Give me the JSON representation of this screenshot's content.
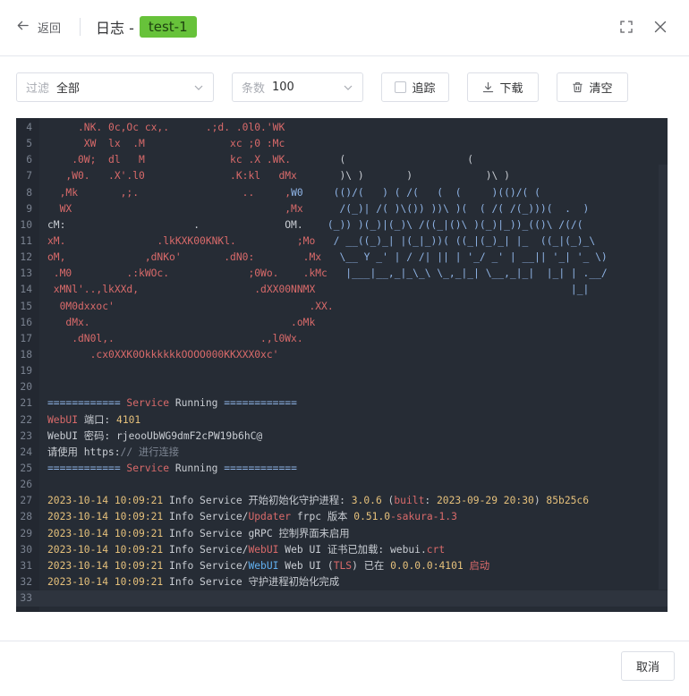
{
  "header": {
    "back_label": "返回",
    "title": "日志 -",
    "tag": "test-1",
    "back_icon": "arrow-left-icon",
    "fullscreen_icon": "fullscreen-icon",
    "close_icon": "close-icon"
  },
  "toolbar": {
    "filter": {
      "label": "过滤",
      "value": "全部"
    },
    "count": {
      "label": "条数",
      "value": "100"
    },
    "track_label": "追踪",
    "download_label": "下载",
    "clear_label": "清空"
  },
  "footer": {
    "cancel_label": "取消"
  },
  "colors": {
    "accent_green": "#67c23a",
    "console_bg": "#262c35",
    "ascii_red": "#d96a6a",
    "ascii_blue": "#8fb4e6",
    "timestamp_yellow": "#e5c07b",
    "link_blue": "#61afef"
  },
  "console": {
    "lines": [
      {
        "n": "4",
        "segs": [
          {
            "t": "     .NK. 0c,Oc cx,.      .;d. .0l0.'WK",
            "c": "r"
          }
        ]
      },
      {
        "n": "5",
        "segs": [
          {
            "t": "      XW  lx  .M              xc ;0 :Mc",
            "c": "r"
          }
        ]
      },
      {
        "n": "6",
        "segs": [
          {
            "t": "    .0W;  dl   M              kc .X .WK.",
            "c": "r"
          },
          {
            "t": "        (                    (",
            "c": "w"
          }
        ]
      },
      {
        "n": "7",
        "segs": [
          {
            "t": "   ,W0.   .X'.l0              .K:kl   dMx",
            "c": "r"
          },
          {
            "t": "       )\\ )       )            )\\ )",
            "c": "w"
          }
        ]
      },
      {
        "n": "8",
        "segs": [
          {
            "t": "  ,Mk       ,;.                 ..     ,",
            "c": "r"
          },
          {
            "t": "W0",
            "c": "b"
          },
          {
            "t": "     (()/(   ) ( /(   (  (     )(()/( (",
            "c": "b"
          }
        ]
      },
      {
        "n": "9",
        "segs": [
          {
            "t": "  WX                                   ,Mx",
            "c": "r"
          },
          {
            "t": "      /(_)| /( )\\()) ))\\ )(  ( /( /(_)))(  .  )",
            "c": "b"
          }
        ]
      },
      {
        "n": "10",
        "segs": [
          {
            "t": "cM:                     .              OM.",
            "c": "w"
          },
          {
            "t": "    (_)) )(_)|(_)\\ /((_|()\\ )(_)|_))_(()\\ /(/(",
            "c": "b"
          }
        ]
      },
      {
        "n": "11",
        "segs": [
          {
            "t": "xM.               .lkKXK00KNKl.          ;Mo",
            "c": "r"
          },
          {
            "t": "   / __((_)_| |(_|_))( ((_|(_)_| |_  ((_|(_)_\\",
            "c": "b"
          }
        ]
      },
      {
        "n": "12",
        "segs": [
          {
            "t": "oM,             ,dNKo'       .dN0:        .Mx",
            "c": "r"
          },
          {
            "t": "   \\__ Y _' | / /| || | '_/ _' | __|| '_| '_ \\)",
            "c": "b"
          }
        ]
      },
      {
        "n": "13",
        "segs": [
          {
            "t": " .M0         .:kWOc.             ;0Wo.    .kMc",
            "c": "r"
          },
          {
            "t": "   |___|__,_|_\\_\\ \\_,_|_| \\__,_|_|  |_| | .__/",
            "c": "b"
          }
        ]
      },
      {
        "n": "14",
        "segs": [
          {
            "t": " xMNl'..,lkXXd,                   .dXX00NNMX",
            "c": "r"
          },
          {
            "t": "                                          |_|",
            "c": "b"
          }
        ]
      },
      {
        "n": "15",
        "segs": [
          {
            "t": "  0M0dxxoc'                                .XX.",
            "c": "r"
          }
        ]
      },
      {
        "n": "16",
        "segs": [
          {
            "t": "   dMx.                                 .oMk",
            "c": "r"
          }
        ]
      },
      {
        "n": "17",
        "segs": [
          {
            "t": "    .dN0l,.                        .,l0Wx.",
            "c": "r"
          }
        ]
      },
      {
        "n": "18",
        "segs": [
          {
            "t": "       .cx0XXK0OkkkkkkOOOO000KKXXX0xc'",
            "c": "r"
          }
        ]
      },
      {
        "n": "19",
        "segs": []
      },
      {
        "n": "20",
        "segs": []
      },
      {
        "n": "21",
        "segs": [
          {
            "t": "============ ",
            "c": "b"
          },
          {
            "t": "Service",
            "c": "r"
          },
          {
            "t": " Running ",
            "c": "w"
          },
          {
            "t": "============",
            "c": "b"
          }
        ]
      },
      {
        "n": "22",
        "segs": [
          {
            "t": "WebUI",
            "c": "r"
          },
          {
            "t": " 端口: ",
            "c": "w"
          },
          {
            "t": "4101",
            "c": "y"
          }
        ]
      },
      {
        "n": "23",
        "segs": [
          {
            "t": "WebUI 密码: rjeooUbWG9dmF2cPW19b6hC@",
            "c": "w"
          }
        ]
      },
      {
        "n": "24",
        "segs": [
          {
            "t": "请使用 https:",
            "c": "w"
          },
          {
            "t": "// 进行连接",
            "c": "g"
          }
        ]
      },
      {
        "n": "25",
        "segs": [
          {
            "t": "============ ",
            "c": "b"
          },
          {
            "t": "Service",
            "c": "r"
          },
          {
            "t": " Running ",
            "c": "w"
          },
          {
            "t": "============",
            "c": "b"
          }
        ]
      },
      {
        "n": "26",
        "segs": []
      },
      {
        "n": "27",
        "segs": [
          {
            "t": "2023-10-14 10:09:21",
            "c": "y"
          },
          {
            "t": " Info Service 开始初始化守护进程: ",
            "c": "w"
          },
          {
            "t": "3.0.6",
            "c": "y"
          },
          {
            "t": " (",
            "c": "w"
          },
          {
            "t": "built",
            "c": "r"
          },
          {
            "t": ": ",
            "c": "w"
          },
          {
            "t": "2023-09-29 20:30",
            "c": "y"
          },
          {
            "t": ") ",
            "c": "w"
          },
          {
            "t": "85b25c6",
            "c": "y"
          }
        ]
      },
      {
        "n": "28",
        "segs": [
          {
            "t": "2023-10-14 10:09:21",
            "c": "y"
          },
          {
            "t": " Info Service/",
            "c": "w"
          },
          {
            "t": "Updater",
            "c": "r"
          },
          {
            "t": " frpc 版本 ",
            "c": "w"
          },
          {
            "t": "0.51.0",
            "c": "y"
          },
          {
            "t": "-sakura-1.3",
            "c": "r"
          }
        ]
      },
      {
        "n": "29",
        "segs": [
          {
            "t": "2023-10-14 10:09:21",
            "c": "y"
          },
          {
            "t": " Info Service gRPC 控制界面未启用",
            "c": "w"
          }
        ]
      },
      {
        "n": "30",
        "segs": [
          {
            "t": "2023-10-14 10:09:21",
            "c": "y"
          },
          {
            "t": " Info Service/",
            "c": "w"
          },
          {
            "t": "WebUI",
            "c": "r"
          },
          {
            "t": " Web UI 证书已加载: webui.",
            "c": "w"
          },
          {
            "t": "crt",
            "c": "r"
          }
        ]
      },
      {
        "n": "31",
        "segs": [
          {
            "t": "2023-10-14 10:09:21",
            "c": "y"
          },
          {
            "t": " Info Service/",
            "c": "w"
          },
          {
            "t": "WebUI",
            "c": "l"
          },
          {
            "t": " Web UI (",
            "c": "w"
          },
          {
            "t": "TLS",
            "c": "r"
          },
          {
            "t": ") 已在 ",
            "c": "w"
          },
          {
            "t": "0.0.0.0:4101",
            "c": "y"
          },
          {
            "t": " ",
            "c": "w"
          },
          {
            "t": "启动",
            "c": "r"
          }
        ]
      },
      {
        "n": "32",
        "segs": [
          {
            "t": "2023-10-14 10:09:21",
            "c": "y"
          },
          {
            "t": " Info Service 守护进程初始化完成",
            "c": "w"
          }
        ]
      },
      {
        "n": "33",
        "segs": []
      }
    ]
  }
}
